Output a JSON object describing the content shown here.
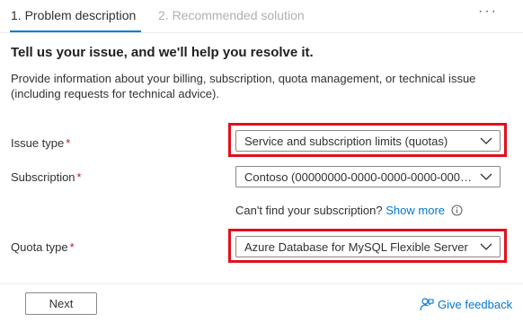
{
  "tabs": [
    {
      "label": "1. Problem description",
      "active": true
    },
    {
      "label": "2. Recommended solution",
      "active": false
    }
  ],
  "more_label": "···",
  "heading": "Tell us your issue, and we'll help you resolve it.",
  "description": "Provide information about your billing, subscription, quota management, or technical issue (including requests for technical advice).",
  "required_marker": "*",
  "fields": {
    "issue_type": {
      "label": "Issue type",
      "value": "Service and subscription limits (quotas)"
    },
    "subscription": {
      "label": "Subscription",
      "value": "Contoso (00000000-0000-0000-0000-0000..."
    },
    "quota_type": {
      "label": "Quota type",
      "value": "Azure Database for MySQL Flexible Server"
    }
  },
  "helper": {
    "text": "Can't find your subscription?",
    "link": "Show more"
  },
  "footer": {
    "next_label": "Next",
    "feedback_label": "Give feedback"
  },
  "colors": {
    "accent": "#0078d4",
    "highlight": "#e0101d",
    "required": "#a4262c"
  }
}
